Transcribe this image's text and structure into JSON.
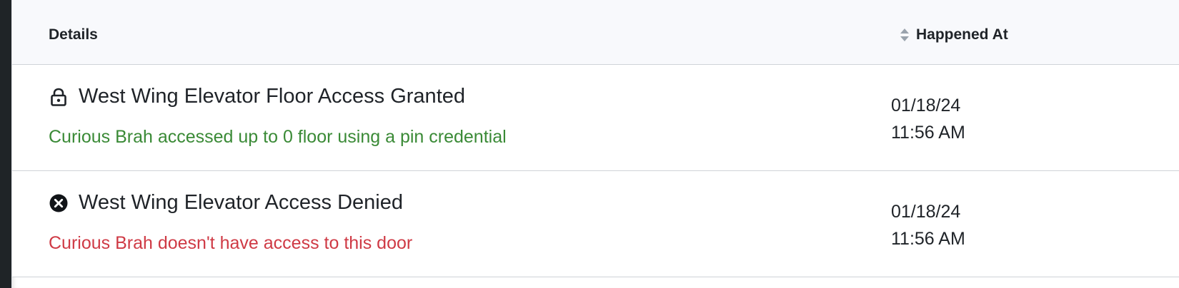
{
  "table": {
    "headers": {
      "details": "Details",
      "happened_at": "Happened At"
    },
    "rows": [
      {
        "icon": "lock-icon",
        "title": "West Wing Elevator Floor Access Granted",
        "description": "Curious Brah accessed up to 0 floor using a pin credential",
        "date": "01/18/24",
        "time": "11:56 AM",
        "status_color": "#3a8a36"
      },
      {
        "icon": "denied-circle-x-icon",
        "title": "West Wing Elevator Access Denied",
        "description": "Curious Brah doesn't have access to this door",
        "date": "01/18/24",
        "time": "11:56 AM",
        "status_color": "#cf3a45"
      }
    ]
  }
}
